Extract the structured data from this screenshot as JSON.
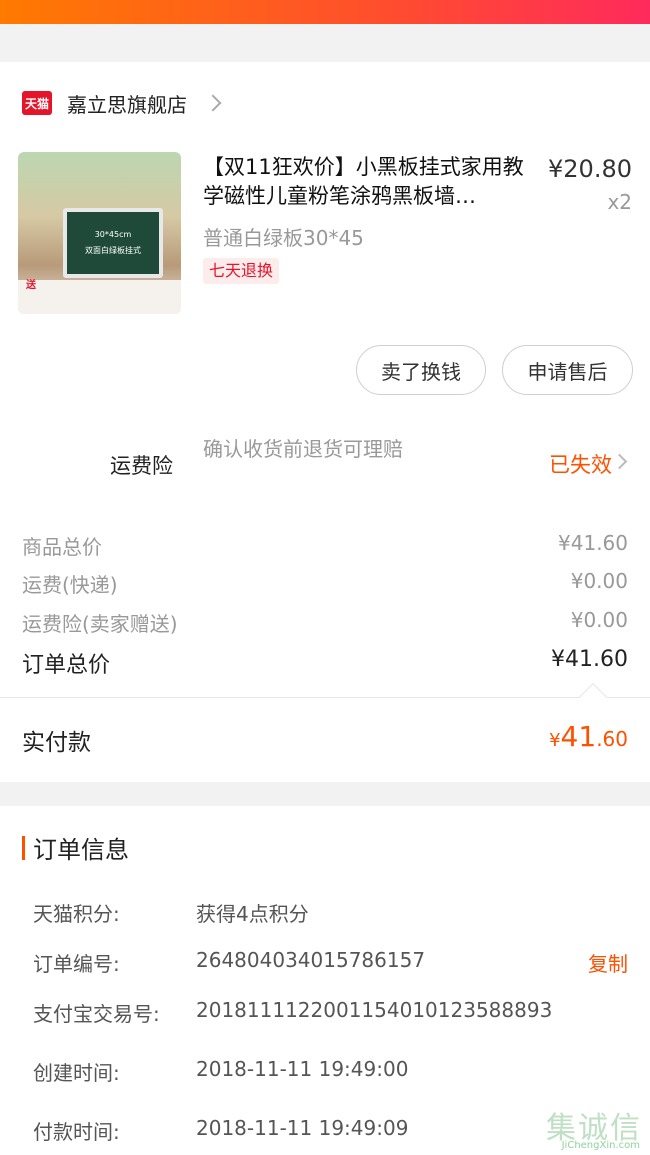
{
  "shop": {
    "badge": "天猫",
    "name": "嘉立思旗舰店"
  },
  "product": {
    "thumb_size_text": "30*45cm",
    "thumb_board_text": "双面白绿板挂式",
    "thumb_tag": "送",
    "title": "【双11狂欢价】小黑板挂式家用教学磁性儿童粉笔涂鸦黑板墙…",
    "price": "¥20.80",
    "qty": "x2",
    "spec": "普通白绿板30*45",
    "tag": "七天退换"
  },
  "actions": {
    "sell": "卖了换钱",
    "after_sale": "申请售后"
  },
  "insurance": {
    "label": "运费险",
    "desc": "确认收货前退货可理赔",
    "status": "已失效"
  },
  "summary": {
    "goods_total_label": "商品总价",
    "goods_total": "¥41.60",
    "shipping_label": "运费(快递)",
    "shipping": "¥0.00",
    "ins_fee_label": "运费险(卖家赠送)",
    "ins_fee": "¥0.00",
    "order_total_label": "订单总价",
    "order_total": "¥41.60",
    "paid_label": "实付款",
    "paid_symbol": "¥",
    "paid_int": "41",
    "paid_dec": ".60"
  },
  "order_info": {
    "title": "订单信息",
    "points_label": "天猫积分:",
    "points": "获得4点积分",
    "order_no_label": "订单编号:",
    "order_no": "264804034015786157",
    "copy": "复制",
    "alipay_label": "支付宝交易号:",
    "alipay": "2018111122001154010123588893",
    "created_label": "创建时间:",
    "created": "2018-11-11 19:49:00",
    "paid_time_label": "付款时间:",
    "paid_time": "2018-11-11 19:49:09"
  },
  "watermark": {
    "text": "集诚信",
    "url": "JiChengXin.com"
  },
  "colors": {
    "accent": "#ff5000",
    "tmall_red": "#e4142b"
  }
}
